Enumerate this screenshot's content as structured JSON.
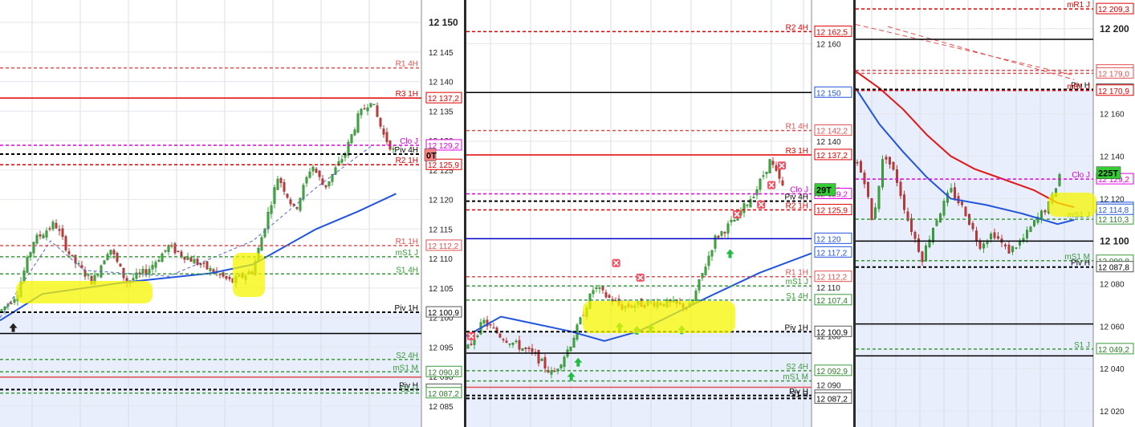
{
  "chart_data": [
    {
      "type": "candlestick",
      "panel": "left",
      "y_axis_ticks": [
        "12 150",
        "12 145",
        "12 140",
        "12 135",
        "12 130",
        "12 125",
        "12 120",
        "12 115",
        "12 110",
        "12 105",
        "12 100",
        "12 095",
        "12 090",
        "12 085"
      ],
      "ylim": [
        12082,
        12153
      ],
      "levels": [
        {
          "name": "R1 4H",
          "value": 12142.3,
          "color": "#e05050",
          "style": "dash"
        },
        {
          "name": "R3 1H",
          "value": 12137.2,
          "color": "#e00000",
          "style": "solid",
          "tag": "12 137,2"
        },
        {
          "name": "Clo J",
          "value": 12129.2,
          "color": "#e000e0",
          "style": "dash",
          "tag": "12 129,2"
        },
        {
          "name": "Piv 4H",
          "value": 12127.7,
          "color": "#000000",
          "style": "dash"
        },
        {
          "name": "R2 1H",
          "value": 12125.9,
          "color": "#e00000",
          "style": "dash",
          "tag": "12 125,9"
        },
        {
          "name": "R1 1H",
          "value": 12112.2,
          "color": "#e05050",
          "style": "dash",
          "tag": "12 112,2"
        },
        {
          "name": "mS1 J",
          "value": 12110.3,
          "color": "#3a9a3a",
          "style": "dash"
        },
        {
          "name": "S1 4H",
          "value": 12107.4,
          "color": "#3a9a3a",
          "style": "dash"
        },
        {
          "name": "Piv 1H",
          "value": 12100.9,
          "color": "#000000",
          "style": "dash",
          "tag": "12 100,9"
        },
        {
          "name": "",
          "value": 12097.3,
          "color": "#000000",
          "style": "solid"
        },
        {
          "name": "S2 4H",
          "value": 12092.9,
          "color": "#3a9a3a",
          "style": "dash"
        },
        {
          "name": "mS1 M",
          "value": 12090.8,
          "color": "#3a9a3a",
          "style": "dash",
          "tag": "12 090,8"
        },
        {
          "name": "",
          "value": 12089.9,
          "color": "#e05050",
          "style": "solid"
        },
        {
          "name": "Piv H",
          "value": 12087.8,
          "color": "#000000",
          "style": "dash",
          "tag": "12 087,8"
        },
        {
          "name": "S1 H",
          "value": 12087.2,
          "color": "#3a9a3a",
          "style": "dash",
          "tag": "12 087,2"
        }
      ],
      "current_tag": "0T",
      "ma_blue": [
        [
          0.0,
          12099.5
        ],
        [
          0.1,
          12104
        ],
        [
          0.3,
          12106
        ],
        [
          0.5,
          12107.5
        ],
        [
          0.6,
          12109
        ],
        [
          0.75,
          12115
        ],
        [
          0.85,
          12118
        ],
        [
          0.94,
          12121
        ]
      ],
      "ma_dash": [
        [
          0.0,
          12100
        ],
        [
          0.12,
          12113
        ],
        [
          0.2,
          12108
        ],
        [
          0.4,
          12107
        ],
        [
          0.6,
          12113
        ],
        [
          0.75,
          12122
        ],
        [
          0.88,
          12129
        ]
      ],
      "path": [
        [
          0.0,
          12101
        ],
        [
          0.04,
          12104
        ],
        [
          0.08,
          12113
        ],
        [
          0.13,
          12116
        ],
        [
          0.17,
          12110
        ],
        [
          0.22,
          12106
        ],
        [
          0.26,
          12112
        ],
        [
          0.3,
          12106
        ],
        [
          0.35,
          12108
        ],
        [
          0.4,
          12112
        ],
        [
          0.45,
          12110
        ],
        [
          0.5,
          12108
        ],
        [
          0.55,
          12106
        ],
        [
          0.6,
          12108
        ],
        [
          0.63,
          12116
        ],
        [
          0.66,
          12124
        ],
        [
          0.7,
          12118
        ],
        [
          0.74,
          12126
        ],
        [
          0.77,
          12122
        ],
        [
          0.82,
          12128
        ],
        [
          0.85,
          12134
        ],
        [
          0.88,
          12137
        ],
        [
          0.91,
          12131
        ],
        [
          0.94,
          12127.5
        ]
      ],
      "arrows_up": [
        0.02
      ]
    },
    {
      "type": "candlestick",
      "panel": "middle",
      "y_axis_ticks": [
        "12 160",
        "12 150",
        "12 140",
        "12 130",
        "12 120",
        "12 110",
        "12 100",
        "12 090"
      ],
      "ylim": [
        12082,
        12168
      ],
      "levels": [
        {
          "name": "R2 4H",
          "value": 12162.5,
          "color": "#e00000",
          "style": "dash",
          "tag": "12 162,5"
        },
        {
          "name": "",
          "value": 12150,
          "color": "#000000",
          "style": "solid"
        },
        {
          "name": "R1 4H",
          "value": 12142.2,
          "color": "#e05050",
          "style": "dash",
          "tag": "12 142,2"
        },
        {
          "name": "R3 1H",
          "value": 12137.2,
          "color": "#e00000",
          "style": "solid",
          "tag": "12 137,2"
        },
        {
          "name": "Clo J",
          "value": 12129.2,
          "color": "#e000e0",
          "style": "dash",
          "tag": "12 129,2"
        },
        {
          "name": "Piv 4H",
          "value": 12127.7,
          "color": "#000000",
          "style": "dash"
        },
        {
          "name": "R2 1H",
          "value": 12125.9,
          "color": "#e00000",
          "style": "dash",
          "tag": "12 125,9"
        },
        {
          "name": "",
          "value": 12120,
          "color": "#0000cc",
          "style": "solid"
        },
        {
          "name": "R1 1H",
          "value": 12112.2,
          "color": "#e05050",
          "style": "dash",
          "tag": "12 112,2"
        },
        {
          "name": "mS1 J",
          "value": 12110.3,
          "color": "#3a9a3a",
          "style": "dash"
        },
        {
          "name": "S1 4H",
          "value": 12107.4,
          "color": "#3a9a3a",
          "style": "dash",
          "tag": "12 107,4"
        },
        {
          "name": "Piv 1H",
          "value": 12100.9,
          "color": "#000000",
          "style": "dash",
          "tag": "12 100,9"
        },
        {
          "name": "",
          "value": 12096.5,
          "color": "#000000",
          "style": "solid"
        },
        {
          "name": "S2 4H",
          "value": 12092.9,
          "color": "#3a9a3a",
          "style": "dash",
          "tag": "12 092,9"
        },
        {
          "name": "mS1 M",
          "value": 12090.8,
          "color": "#3a9a3a",
          "style": "dash"
        },
        {
          "name": "",
          "value": 12089.5,
          "color": "#e05050",
          "style": "solid"
        },
        {
          "name": "Piv H",
          "value": 12087.8,
          "color": "#000000",
          "style": "dash",
          "tag": "12 087,8"
        },
        {
          "name": "S1 H",
          "value": 12087.2,
          "color": "#000000",
          "style": "dash",
          "tag": "12 087,2"
        }
      ],
      "current_tag": "29T",
      "extra_tags": [
        "12 117,2",
        "12 150",
        "12 120"
      ],
      "ma_blue": [
        [
          0.0,
          12100
        ],
        [
          0.1,
          12104
        ],
        [
          0.3,
          12101
        ],
        [
          0.4,
          12099
        ],
        [
          0.5,
          12101
        ],
        [
          0.7,
          12108
        ],
        [
          0.85,
          12113
        ],
        [
          1.0,
          12117
        ]
      ],
      "path": [
        [
          0.0,
          12097
        ],
        [
          0.05,
          12103
        ],
        [
          0.1,
          12100
        ],
        [
          0.2,
          12096
        ],
        [
          0.25,
          12092
        ],
        [
          0.3,
          12098
        ],
        [
          0.37,
          12110
        ],
        [
          0.45,
          12106
        ],
        [
          0.55,
          12107
        ],
        [
          0.65,
          12106
        ],
        [
          0.72,
          12120
        ],
        [
          0.78,
          12124
        ],
        [
          0.84,
          12130
        ],
        [
          0.88,
          12136
        ],
        [
          0.92,
          12130
        ]
      ],
      "crosses": [
        [
          0.0,
          12100
        ],
        [
          0.42,
          12115
        ],
        [
          0.49,
          12112
        ],
        [
          0.77,
          12125
        ],
        [
          0.84,
          12127
        ],
        [
          0.87,
          12131
        ],
        [
          0.9,
          12135
        ]
      ],
      "arrows_up": [
        0.29,
        0.31,
        0.43,
        0.48,
        0.52,
        0.61,
        0.75
      ]
    },
    {
      "type": "candlestick",
      "panel": "right",
      "y_axis_ticks": [
        "12 200",
        "12 180",
        "12 160",
        "12 140",
        "12 120",
        "12 100",
        "12 080",
        "12 060",
        "12 040",
        "12 020"
      ],
      "ylim": [
        12014,
        12212
      ],
      "levels": [
        {
          "name": "mR1 J",
          "value": 12209.3,
          "color": "#e00000",
          "style": "dash",
          "tag": "12 209,3"
        },
        {
          "name": "",
          "value": 12195,
          "color": "#000000",
          "style": "solid"
        },
        {
          "name": "",
          "value": 12180.4,
          "color": "#e05050",
          "style": "dash",
          "tag": "12 180,4"
        },
        {
          "name": "",
          "value": 12179.0,
          "color": "#e05050",
          "style": "dash",
          "tag": "12 179,0"
        },
        {
          "name": "Piv H",
          "value": 12171.4,
          "color": "#000000",
          "style": "dash",
          "tag": "12 171,4"
        },
        {
          "name": "mR1 J",
          "value": 12170.9,
          "color": "#e00000",
          "style": "dash",
          "tag": "12 170,9"
        },
        {
          "name": "Clo J",
          "value": 12129.2,
          "color": "#e000e0",
          "style": "dash",
          "tag": "12 129,2"
        },
        {
          "name": "mS1 J",
          "value": 12110.3,
          "color": "#3a9a3a",
          "style": "dash",
          "tag": "12 110,3"
        },
        {
          "name": "",
          "value": 12100,
          "color": "#000000",
          "style": "solid"
        },
        {
          "name": "mS1 M",
          "value": 12090.8,
          "color": "#3a9a3a",
          "style": "dash",
          "tag": "12 090,8"
        },
        {
          "name": "Piv H",
          "value": 12087.8,
          "color": "#000000",
          "style": "dash",
          "tag": "12 087,8"
        },
        {
          "name": "",
          "value": 12061,
          "color": "#000000",
          "style": "solid"
        },
        {
          "name": "S1 J",
          "value": 12049.2,
          "color": "#3a9a3a",
          "style": "dash",
          "tag": "12 049,2"
        },
        {
          "name": "",
          "value": 12046,
          "color": "#000000",
          "style": "solid"
        }
      ],
      "current_tag": "225T",
      "extra_tags": [
        "12 115,7",
        "12 114,8"
      ],
      "ma_red": [
        [
          0.0,
          12180
        ],
        [
          0.1,
          12172
        ],
        [
          0.2,
          12162
        ],
        [
          0.3,
          12150
        ],
        [
          0.4,
          12140
        ],
        [
          0.5,
          12134
        ],
        [
          0.6,
          12130
        ],
        [
          0.75,
          12124
        ],
        [
          0.85,
          12118
        ],
        [
          0.92,
          12116
        ]
      ],
      "ma_blue": [
        [
          0.0,
          12172
        ],
        [
          0.1,
          12155
        ],
        [
          0.2,
          12142
        ],
        [
          0.3,
          12130
        ],
        [
          0.4,
          12120
        ],
        [
          0.55,
          12117
        ],
        [
          0.7,
          12113
        ],
        [
          0.85,
          12108
        ],
        [
          0.92,
          12110
        ]
      ],
      "path": [
        [
          0.0,
          12138
        ],
        [
          0.04,
          12128
        ],
        [
          0.07,
          12108
        ],
        [
          0.12,
          12142
        ],
        [
          0.17,
          12130
        ],
        [
          0.22,
          12110
        ],
        [
          0.28,
          12092
        ],
        [
          0.33,
          12108
        ],
        [
          0.4,
          12124
        ],
        [
          0.46,
          12114
        ],
        [
          0.52,
          12098
        ],
        [
          0.58,
          12104
        ],
        [
          0.64,
          12095
        ],
        [
          0.7,
          12100
        ],
        [
          0.76,
          12110
        ],
        [
          0.82,
          12118
        ],
        [
          0.86,
          12132
        ]
      ],
      "mr_trend": [
        [
          0.0,
          12202
        ],
        [
          0.92,
          12178
        ]
      ]
    }
  ]
}
